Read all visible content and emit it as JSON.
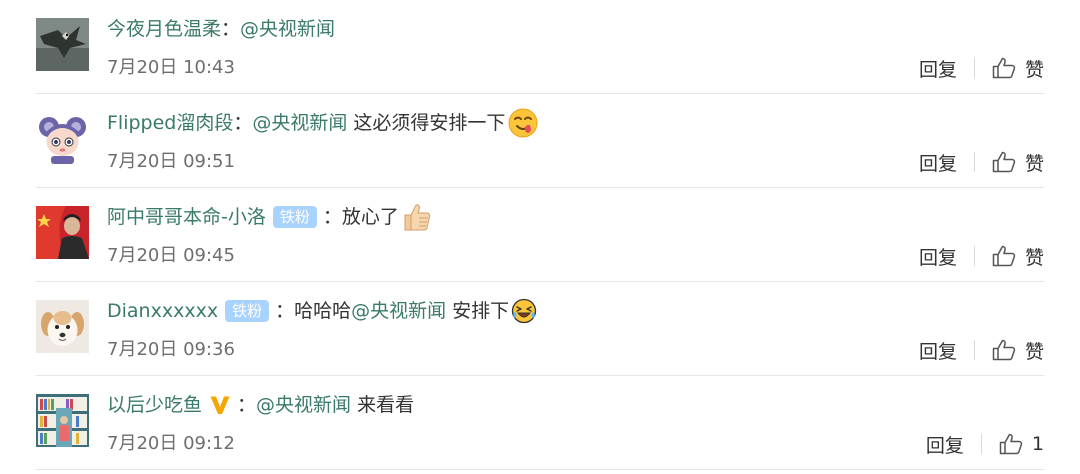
{
  "comments": [
    {
      "username": "今夜月色温柔",
      "colon": "：",
      "mention": "@央视新闻",
      "text": "",
      "time": "7月20日 10:43",
      "reply_label": "回复",
      "like_label": "赞",
      "avatar_icon": "eagle-avatar"
    },
    {
      "username": "Flipped溜肉段",
      "colon": "：",
      "mention": "@央视新闻",
      "text": " 这必须得安排一下",
      "emoji_icon": "drooling-face-emoji",
      "time": "7月20日 09:51",
      "reply_label": "回复",
      "like_label": "赞",
      "avatar_icon": "cartoon-mouse-avatar"
    },
    {
      "username": "阿中哥哥本命-小洛",
      "badge": "铁粉",
      "colon": "：",
      "text": "放心了",
      "emoji_icon": "thumbs-up-emoji",
      "time": "7月20日 09:45",
      "reply_label": "回复",
      "like_label": "赞",
      "avatar_icon": "flag-person-avatar"
    },
    {
      "username": "Dianxxxxxx",
      "badge": "铁粉",
      "colon": "：",
      "text_before": "哈哈哈",
      "mention": "@央视新闻",
      "text": " 安排下",
      "emoji_icon": "laughing-tears-emoji",
      "time": "7月20日 09:36",
      "reply_label": "回复",
      "like_label": "赞",
      "avatar_icon": "puppy-avatar"
    },
    {
      "username": "以后少吃鱼",
      "verified_icon": "yellow-v-badge",
      "colon": "：",
      "mention": "@央视新闻",
      "text": " 来看看",
      "time": "7月20日 09:12",
      "reply_label": "回复",
      "like_count": "1",
      "avatar_icon": "bookshelf-avatar"
    }
  ],
  "colors": {
    "username": "#3a7a6b",
    "text": "#333333",
    "timestamp": "#6e6e6e",
    "badge_bg": "#a9d3ff",
    "divider": "#e6e6e6"
  }
}
